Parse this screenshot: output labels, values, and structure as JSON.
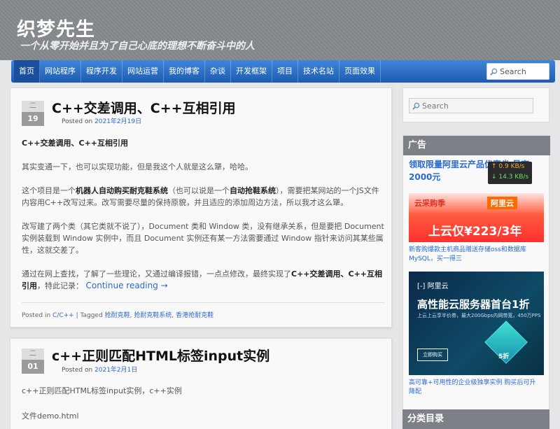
{
  "site": {
    "title": "织梦先生",
    "description": "一个从零开始并且为了自己心底的理想不断奋斗中的人"
  },
  "nav": {
    "items": [
      "首页",
      "网站程序",
      "程序开发",
      "网站运营",
      "我的博客",
      "杂谈",
      "开发框架",
      "项目",
      "技术名站",
      "页面效果"
    ],
    "active_index": 0,
    "search_placeholder": "Search"
  },
  "posts": [
    {
      "month": "二",
      "day": "19",
      "title": "C++交差调用、C++互相引用",
      "posted_on_label": "Posted on",
      "date": "2021年2月19日",
      "heading": "C++交差调用、C++互相引用",
      "p1": "其实变通一下，也可以实现功能，但是我这个人就是这么犟，哈哈。",
      "p2a": "这个项目是一个",
      "p2b": "机器人自动购买耐克鞋系统",
      "p2c": "（也可以说是一个",
      "p2d": "自动抢鞋系统",
      "p2e": "），需要把某网站的一个JS文件内容用C++改写过来。改写需要尽量的保持原貌，并且适应的添加周边方法，所以我才这么犟。",
      "p3": "改写建了两个类（其它类就不说了），Document 类和 Window 类，没有继承关系，但是要把 Document 实例装载到 Window 实例中，而且 Document 实例还有某一方法需要通过 Window 指针来访问其某些属性，这就交差了。",
      "p4a": "通过在网上查找，了解了一些理论，又通过编译报错，一点点修改，最终实现了",
      "p4b": "C++交差调用、C++互相引用",
      "p4c": "，特此记录：",
      "continue": "Continue reading →",
      "posted_in_label": "Posted in",
      "category": "C/C++",
      "tagged_label": "| Tagged",
      "tags": [
        "抢耐克鞋",
        "抢耐克鞋系统",
        "香港抢耐克鞋"
      ]
    },
    {
      "month": "二",
      "day": "01",
      "title": "c++正则匹配HTML标签input实例",
      "posted_on_label": "Posted on",
      "date": "2021年2月1日",
      "p1": "c++正则匹配HTML标签input实例，c++实例",
      "p2": "文件demo.html"
    }
  ],
  "sidebar": {
    "search_placeholder": "Search",
    "ad_title": "广告",
    "ad_headline": "领取限量阿里云产品优惠券 最高2000元",
    "speed_up": "↑ 0.9 KB/s",
    "speed_down": "↓ 14.3 KB/s",
    "banner1_left": "云采购季",
    "banner1_right": "阿里云",
    "banner1_main": "上云仅¥223/3年",
    "caption1": "新客购爆款主机商品赠送存储oss和数据库MySQL，买一得三",
    "banner2_brand": "[-] 阿里云",
    "banner2_title": "高性能云服务器首台1折",
    "banner2_sub": "上云上云享半价券，最大200Gbps内网带宽，450万PPS",
    "banner2_button": "立即购买",
    "banner2_cube": "5折",
    "caption2": "高可靠+可用性的企业级独享实例 购买后可升降配",
    "category_title": "分类目录"
  },
  "colors": {
    "nav": "#2b6cc4",
    "link": "#2a6ad0",
    "widget_title": "#7d8187",
    "header": "#85898d"
  }
}
